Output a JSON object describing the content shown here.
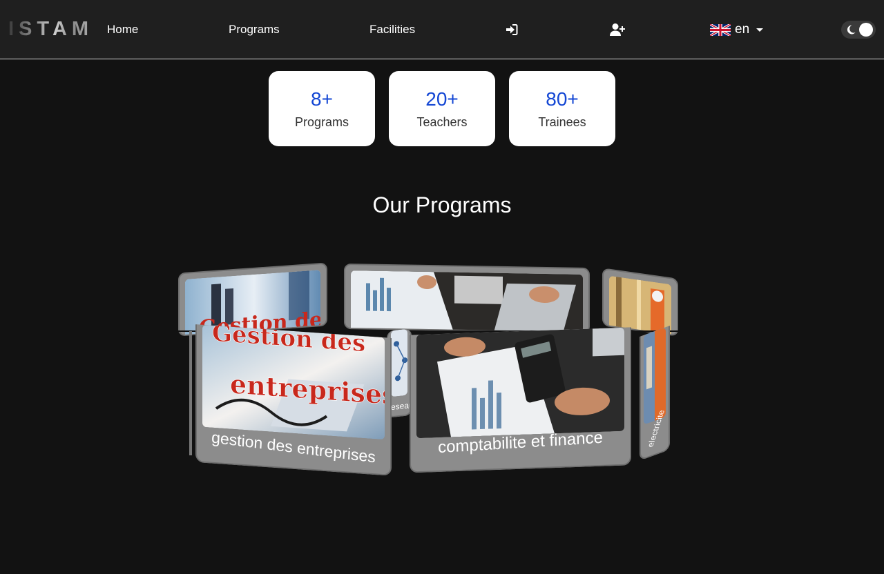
{
  "brand": {
    "name": "ISTAM"
  },
  "nav": {
    "home": "Home",
    "programs": "Programs",
    "facilities": "Facilities",
    "login_icon": "sign-in-icon",
    "register_icon": "user-plus-icon",
    "language": {
      "flag": "uk-flag-icon",
      "label": "en"
    },
    "theme_toggle": {
      "icon": "moon-icon",
      "state": "dark"
    }
  },
  "stats": [
    {
      "value": "8+",
      "label": "Programs"
    },
    {
      "value": "20+",
      "label": "Teachers"
    },
    {
      "value": "80+",
      "label": "Trainees"
    }
  ],
  "programs_section": {
    "title": "Our Programs",
    "cards": [
      {
        "label": "gestion des entreprises",
        "image_text": "Gestion des entreprises"
      },
      {
        "label": "comptabilite et finance"
      },
      {
        "label": "reseau"
      },
      {
        "label": "electricite"
      }
    ]
  },
  "colors": {
    "navbar_bg": "#1f1f1f",
    "page_bg": "#121212",
    "stat_value": "#1447d4",
    "card_frame": "#8c8c8c"
  }
}
